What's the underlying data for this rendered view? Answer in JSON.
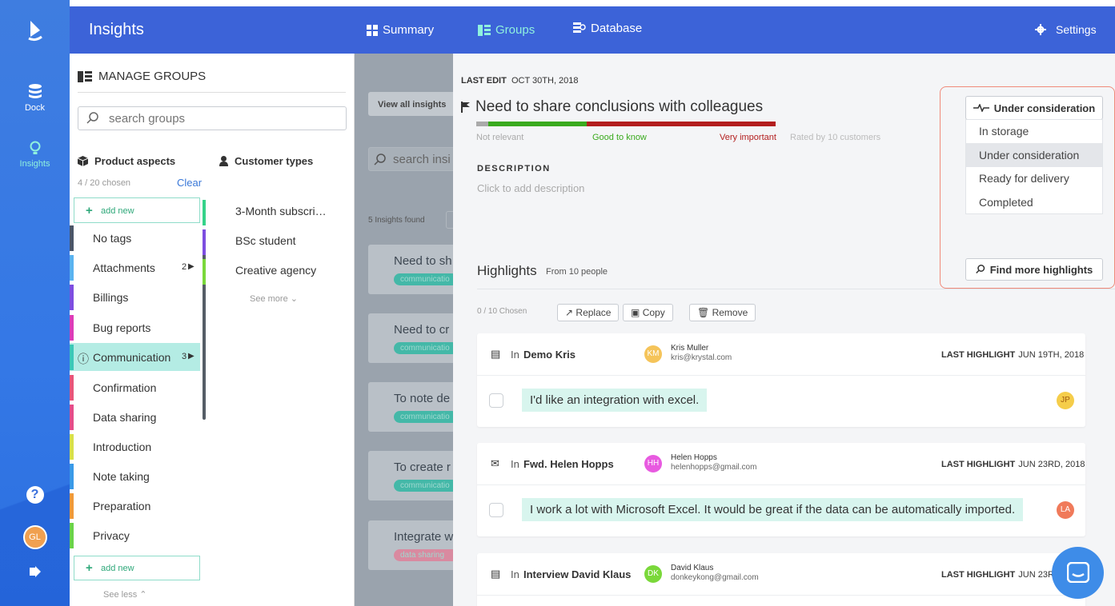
{
  "rail": {
    "dock_label": "Dock",
    "insights_label": "Insights",
    "avatar_initials": "GL"
  },
  "topbar": {
    "title": "Insights",
    "nav": [
      {
        "label": "Summary",
        "icon": "summary-icon"
      },
      {
        "label": "Groups",
        "icon": "groups-icon"
      },
      {
        "label": "Database",
        "icon": "database-icon"
      }
    ],
    "settings_label": "Settings",
    "active_color": "#8ff1de"
  },
  "groups": {
    "header": "MANAGE GROUPS",
    "search_placeholder": "search groups",
    "product_aspects_label": "Product aspects",
    "customer_types_label": "Customer types",
    "chosen": "4 / 20 chosen",
    "clear_label": "Clear",
    "add_new": "add new",
    "tags": [
      {
        "label": "No tags",
        "color": "#4a5568",
        "count": ""
      },
      {
        "label": "Attachments",
        "color": "#5ab3f0",
        "count": "2"
      },
      {
        "label": "Billings",
        "color": "#7d4ee0",
        "count": ""
      },
      {
        "label": "Bug reports",
        "color": "#dc3cb8",
        "count": ""
      },
      {
        "label": "Communication",
        "color": "#3cc8b8",
        "count": "3"
      },
      {
        "label": "Confirmation",
        "color": "#e8557a",
        "count": ""
      },
      {
        "label": "Data sharing",
        "color": "#e44d8a",
        "count": ""
      },
      {
        "label": "Introduction",
        "color": "#d8e04a",
        "count": ""
      },
      {
        "label": "Note taking",
        "color": "#3a9ae8",
        "count": ""
      },
      {
        "label": "Preparation",
        "color": "#f09a3a",
        "count": ""
      },
      {
        "label": "Privacy",
        "color": "#6ad34a",
        "count": ""
      }
    ],
    "customer_types": [
      {
        "label": "3-Month subscri…",
        "color": "#35d38a"
      },
      {
        "label": "BSc student",
        "color": "#7d4ee0"
      },
      {
        "label": "Creative agency",
        "color": "#7ad83a"
      }
    ],
    "see_more": "See more",
    "see_less": "See less"
  },
  "middle": {
    "view_all": "View all insights",
    "search_placeholder": "search insi",
    "found": "5 Insights found",
    "cards": [
      {
        "title": "Need to sh",
        "chip": "communicatio",
        "chip_color": "#44b8a8"
      },
      {
        "title": "Need to cr",
        "chip": "communicatio",
        "chip_color": "#44b8a8"
      },
      {
        "title": "To note de",
        "chip": "communicatio",
        "chip_color": "#44b8a8"
      },
      {
        "title": "To create r",
        "chip": "communicatio",
        "chip_color": "#44b8a8"
      },
      {
        "title": "Integrate w",
        "chip": "data sharing",
        "chip_color": "#d98aa0"
      }
    ]
  },
  "detail": {
    "last_edit_label": "LAST EDIT",
    "last_edit_date": "OCT 30TH, 2018",
    "title": "Need to share conclusions with colleagues",
    "rating": {
      "not_relevant": "Not relevant",
      "good": "Good to know",
      "very": "Very important",
      "rated_by": "Rated by 10 customers",
      "fractions": [
        0.04,
        0.33,
        0.63
      ]
    },
    "description_label": "DESCRIPTION",
    "description_placeholder": "Click to add description",
    "status": {
      "current": "Under consideration",
      "options": [
        "In storage",
        "Under consideration",
        "Ready for delivery",
        "Completed"
      ],
      "selected_index": 1
    },
    "find_more": "Find more highlights",
    "highlights_label": "Highlights",
    "highlights_from": "From 10 people",
    "chosen": "0 / 10 Chosen",
    "actions": [
      "Replace",
      "Copy",
      "Remove"
    ],
    "last_highlight_label": "LAST HIGHLIGHT",
    "items": [
      {
        "icon": "document-icon",
        "in": "In",
        "source": "Demo Kris",
        "person": "Kris Muller",
        "email": "kris@krystal.com",
        "initials": "KM",
        "avatar_color": "#f5c45a",
        "date": "JUN 19TH, 2018",
        "quote": "I'd like an integration with excel.",
        "quote_initials": "JP",
        "quote_color": "#f5cd4a"
      },
      {
        "icon": "mail-icon",
        "in": "In",
        "source": "Fwd. Helen Hopps",
        "person": "Helen Hopps",
        "email": "helenhopps@gmail.com",
        "initials": "HH",
        "avatar_color": "#e85ae0",
        "date": "JUN 23RD, 2018",
        "quote": "I work a lot with Microsoft Excel. It would be great if the data can be automatically imported.",
        "quote_initials": "LA",
        "quote_color": "#f07a5a"
      },
      {
        "icon": "document-icon",
        "in": "In",
        "source": "Interview David Klaus",
        "person": "David Klaus",
        "email": "donkeykong@gmail.com",
        "initials": "DK",
        "avatar_color": "#7ad83a",
        "date": "JUN 23R",
        "quote": "",
        "quote_initials": "",
        "quote_color": "#ccc"
      }
    ]
  }
}
